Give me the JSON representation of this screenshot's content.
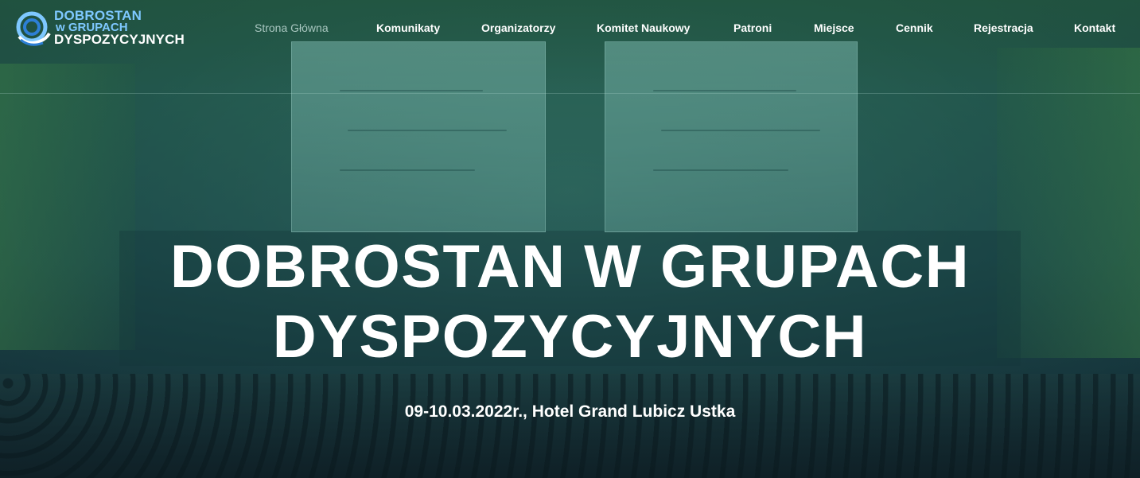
{
  "brand": {
    "line1": "DOBROSTAN",
    "line2": "w GRUPACH",
    "line3": "DYSPOZYCYJNYCH",
    "icon": "conference-logo-icon"
  },
  "nav": {
    "items": [
      {
        "label": "Strona Główna",
        "active": true
      },
      {
        "label": "Komunikaty"
      },
      {
        "label": "Organizatorzy"
      },
      {
        "label": "Komitet Naukowy"
      },
      {
        "label": "Patroni"
      },
      {
        "label": "Miejsce"
      },
      {
        "label": "Cennik"
      },
      {
        "label": "Rejestracja"
      },
      {
        "label": "Kontakt"
      }
    ]
  },
  "hero": {
    "title_line1": "DOBROSTAN W GRUPACH",
    "title_line2": "DYSPOZYCYJNYCH",
    "subtitle": "09-10.03.2022r., Hotel Grand Lubicz Ustka"
  },
  "colors": {
    "overlay": "#1f4e4a",
    "nav_active": "#a9c7c0",
    "logo_blue": "#7ec8ff",
    "text": "#ffffff"
  }
}
